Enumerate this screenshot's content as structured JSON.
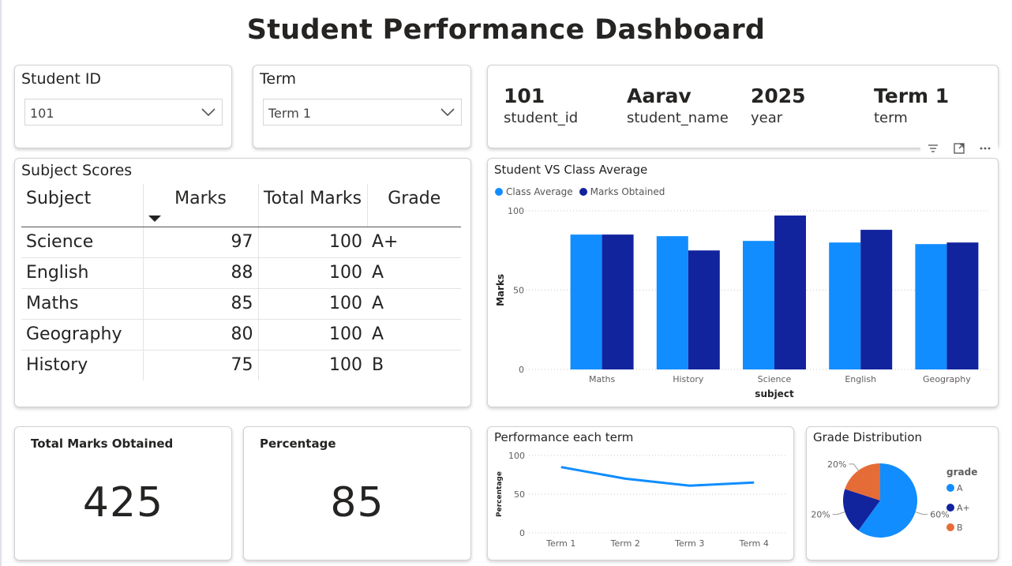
{
  "title": "Student Performance Dashboard",
  "slicers": {
    "student": {
      "label": "Student ID",
      "value": "101"
    },
    "term": {
      "label": "Term",
      "value": "Term 1"
    }
  },
  "multirow": [
    {
      "value": "101",
      "label": "student_id"
    },
    {
      "value": "Aarav",
      "label": "student_name"
    },
    {
      "value": "2025",
      "label": "year"
    },
    {
      "value": "Term 1",
      "label": "term"
    }
  ],
  "table": {
    "title": "Subject Scores",
    "headers": {
      "subject": "Subject",
      "marks": "Marks",
      "total": "Total Marks",
      "grade": "Grade"
    },
    "rows": [
      {
        "subject": "Science",
        "marks": "97",
        "total": "100",
        "grade": "A+"
      },
      {
        "subject": "English",
        "marks": "88",
        "total": "100",
        "grade": "A"
      },
      {
        "subject": "Maths",
        "marks": "85",
        "total": "100",
        "grade": "A"
      },
      {
        "subject": "Geography",
        "marks": "80",
        "total": "100",
        "grade": "A"
      },
      {
        "subject": "History",
        "marks": "75",
        "total": "100",
        "grade": "B"
      }
    ]
  },
  "kpi": {
    "total": {
      "title": "Total Marks Obtained",
      "value": "425"
    },
    "percentage": {
      "title": "Percentage",
      "value": "85"
    }
  },
  "colors": {
    "light_blue": "#118dff",
    "dark_blue": "#12239e",
    "orange": "#e66c37"
  },
  "chart_data": [
    {
      "type": "bar",
      "title": "Student VS Class Average",
      "xlabel": "subject",
      "ylabel": "Marks",
      "ylim": [
        0,
        100
      ],
      "yticks": [
        "0",
        "50",
        "100"
      ],
      "categories": [
        "Maths",
        "History",
        "Science",
        "English",
        "Geography"
      ],
      "series": [
        {
          "name": "Class Average",
          "values": [
            85,
            84,
            81,
            80,
            79
          ]
        },
        {
          "name": "Marks Obtained",
          "values": [
            85,
            75,
            97,
            88,
            80
          ]
        }
      ],
      "legend": "top-left",
      "grid": true
    },
    {
      "type": "line",
      "title": "Performance each term",
      "ylabel": "Percentage",
      "ylim": [
        0,
        100
      ],
      "yticks": [
        "0",
        "50",
        "100"
      ],
      "categories": [
        "Term 1",
        "Term 2",
        "Term 3",
        "Term 4"
      ],
      "values": [
        85,
        70,
        61,
        65
      ],
      "grid": true
    },
    {
      "type": "pie",
      "title": "Grade Distribution",
      "legend_title": "grade",
      "legend": "right",
      "slices": [
        {
          "label": "A",
          "value": 60,
          "text": "60%"
        },
        {
          "label": "A+",
          "value": 20,
          "text": "20%"
        },
        {
          "label": "B",
          "value": 20,
          "text": "20%"
        }
      ]
    }
  ],
  "toolbar": {
    "filter_icon": "filter-icon",
    "focus_icon": "focus-mode-icon",
    "more_icon": "more-options-icon"
  }
}
